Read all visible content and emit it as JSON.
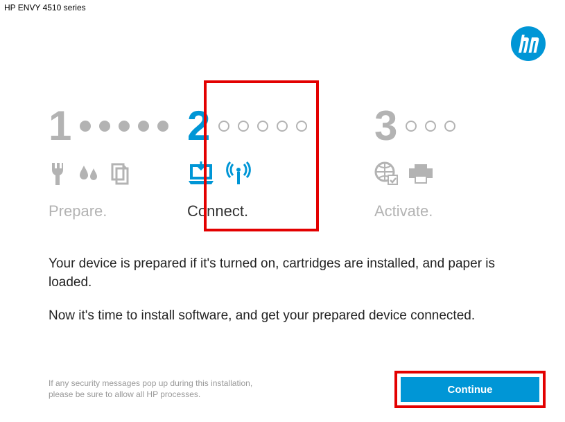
{
  "window_title": "HP ENVY 4510 series",
  "steps": {
    "prepare": {
      "number": "1",
      "label": "Prepare."
    },
    "connect": {
      "number": "2",
      "label": "Connect."
    },
    "activate": {
      "number": "3",
      "label": "Activate."
    }
  },
  "body": {
    "line1": "Your device is prepared if it's turned on, cartridges are installed, and paper is loaded.",
    "line2": "Now it's time to install software, and get your prepared device connected."
  },
  "footer": {
    "security_note": "If any security messages pop up during this installation, please be sure to allow all HP processes.",
    "continue_label": "Continue"
  },
  "colors": {
    "hp_blue": "#0096d6",
    "inactive_gray": "#b3b3b3",
    "highlight_red": "#e30000"
  }
}
